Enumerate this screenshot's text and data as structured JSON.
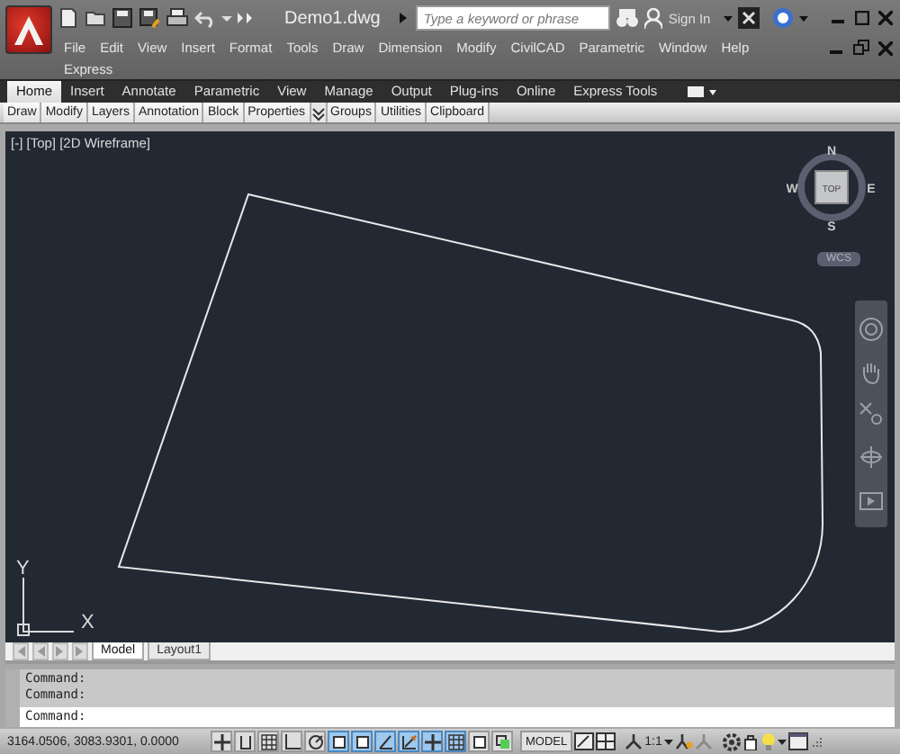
{
  "title": "Demo1.dwg",
  "search": {
    "placeholder": "Type a keyword or phrase"
  },
  "sign_in": "Sign In",
  "menu": [
    "File",
    "Edit",
    "View",
    "Insert",
    "Format",
    "Tools",
    "Draw",
    "Dimension",
    "Modify",
    "CivilCAD",
    "Parametric",
    "Window",
    "Help",
    "Express"
  ],
  "ribbon_tabs": [
    {
      "label": "Home",
      "selected": true
    },
    {
      "label": "Insert",
      "selected": false
    },
    {
      "label": "Annotate",
      "selected": false
    },
    {
      "label": "Parametric",
      "selected": false
    },
    {
      "label": "View",
      "selected": false
    },
    {
      "label": "Manage",
      "selected": false
    },
    {
      "label": "Output",
      "selected": false
    },
    {
      "label": "Plug-ins",
      "selected": false
    },
    {
      "label": "Online",
      "selected": false
    },
    {
      "label": "Express Tools",
      "selected": false
    }
  ],
  "panels": [
    {
      "label": "Draw",
      "kind": "plain"
    },
    {
      "label": "Modify",
      "kind": "plain"
    },
    {
      "label": "Layers",
      "kind": "plain"
    },
    {
      "label": "Annotation",
      "kind": "plain"
    },
    {
      "label": "Block",
      "kind": "plain"
    },
    {
      "label": "Properties",
      "kind": "expand"
    },
    {
      "label": "Groups",
      "kind": "plain"
    },
    {
      "label": "Utilities",
      "kind": "plain"
    },
    {
      "label": "Clipboard",
      "kind": "plain"
    }
  ],
  "viewport": {
    "label": "[-] [Top] [2D Wireframe]",
    "viewcube": {
      "face": "TOP",
      "north": "N",
      "south": "S",
      "east": "E",
      "west": "W"
    },
    "ucs_button": "WCS",
    "axes": {
      "x": "X",
      "y": "Y"
    }
  },
  "layout_tabs": [
    {
      "label": "Model",
      "selected": true
    },
    {
      "label": "Layout1",
      "selected": false
    }
  ],
  "command_history": [
    "Command:",
    "Command:"
  ],
  "command_prompt": "Command:",
  "status": {
    "coordinates": "3164.0506, 3083.9301, 0.0000",
    "toggles": [
      {
        "kind": "cross",
        "on": false
      },
      {
        "kind": "bracket",
        "on": false
      },
      {
        "kind": "grid",
        "on": false
      },
      {
        "kind": "ortho",
        "on": false
      },
      {
        "kind": "circle",
        "on": false
      },
      {
        "kind": "square",
        "on": true
      },
      {
        "kind": "square",
        "on": true
      },
      {
        "kind": "angle",
        "on": true
      },
      {
        "kind": "arrow",
        "on": true
      },
      {
        "kind": "cross",
        "on": true
      },
      {
        "kind": "grid",
        "on": true
      },
      {
        "kind": "square",
        "on": false
      },
      {
        "kind": "stack",
        "on": false
      }
    ],
    "model": "MODEL",
    "annotation_scale": "1:1"
  }
}
